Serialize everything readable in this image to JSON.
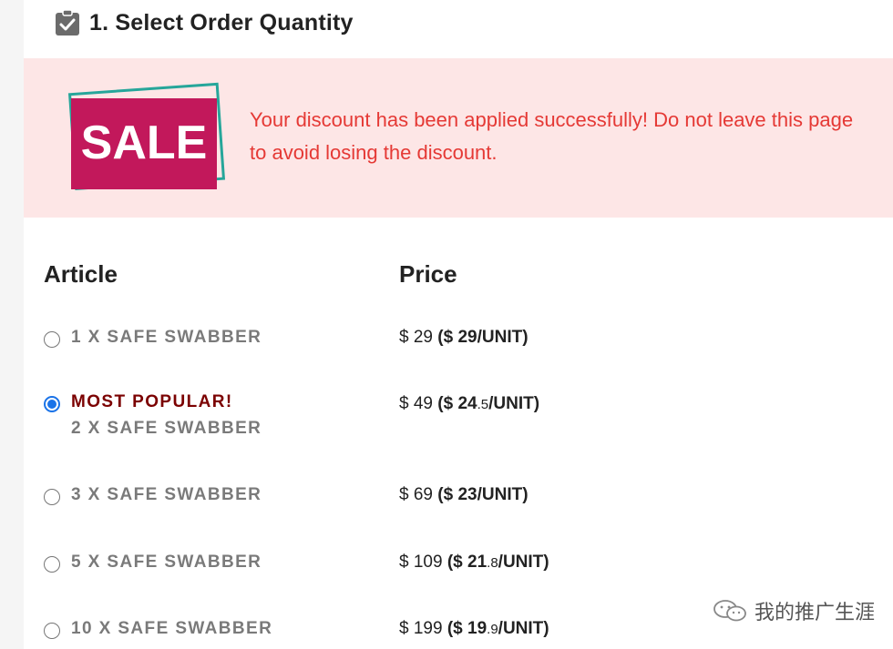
{
  "header": {
    "title": "1. Select Order Quantity",
    "icon": "clipboard-check-icon"
  },
  "banner": {
    "badge_text": "SALE",
    "message": "Your discount has been applied successfully! Do not leave this page to avoid losing the discount.",
    "colors": {
      "background": "#fde6e6",
      "text": "#e53935",
      "badge": "#c2185b",
      "badge_border": "#26a69a"
    }
  },
  "table": {
    "col_article": "Article",
    "col_price": "Price"
  },
  "options": [
    {
      "badge": "",
      "article": "1 X SAFE SWABBER",
      "total": "$ 29",
      "unit_int": "29",
      "unit_dec": "",
      "checked": false
    },
    {
      "badge": "MOST POPULAR!",
      "article": "2 X SAFE SWABBER",
      "total": "$ 49",
      "unit_int": "24",
      "unit_dec": ".5",
      "checked": true
    },
    {
      "badge": "",
      "article": "3 X SAFE SWABBER",
      "total": "$ 69",
      "unit_int": "23",
      "unit_dec": "",
      "checked": false
    },
    {
      "badge": "",
      "article": "5 X SAFE SWABBER",
      "total": "$ 109",
      "unit_int": "21",
      "unit_dec": ".8",
      "checked": false
    },
    {
      "badge": "",
      "article": "10 X SAFE SWABBER",
      "total": "$ 199",
      "unit_int": "19",
      "unit_dec": ".9",
      "checked": false
    }
  ],
  "unit_prefix": "($ ",
  "unit_suffix": "/UNIT)",
  "watermark": {
    "text": "我的推广生涯",
    "icon": "wechat-icon"
  },
  "colors": {
    "accent": "#1a73e8",
    "popular": "#7b0000"
  }
}
